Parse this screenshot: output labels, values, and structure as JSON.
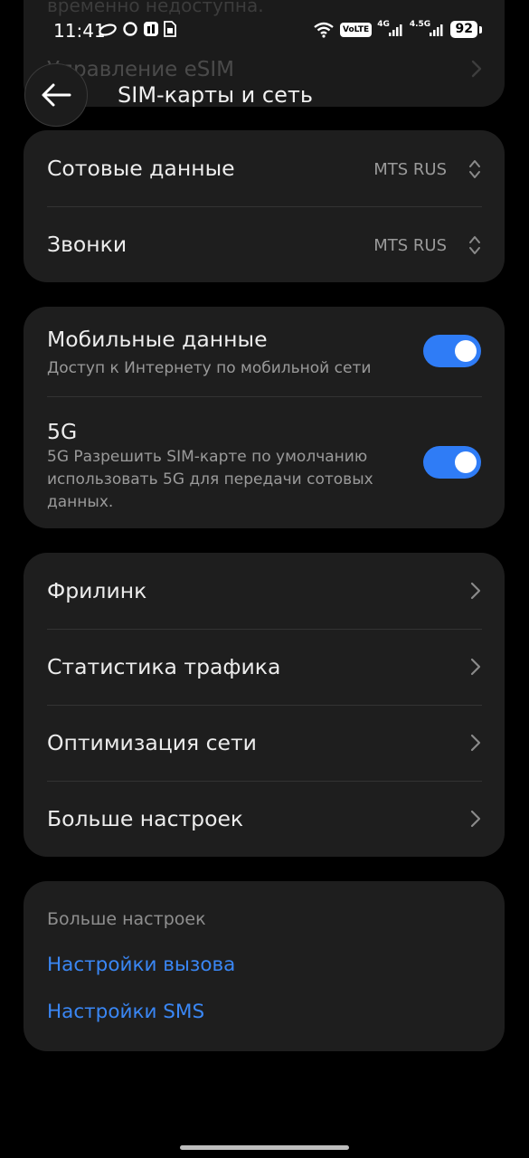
{
  "status_bar": {
    "time": "11:41",
    "volte": "VoLTE",
    "sim1_net": "4G",
    "sim2_net": "4.5G",
    "battery": "92",
    "icons_left": [
      "cloud-icon",
      "chat-icon",
      "notification-icon",
      "sim-icon"
    ],
    "icons_right": [
      "wifi-icon",
      "volte-icon",
      "signal-icon",
      "signal-icon",
      "battery-icon"
    ]
  },
  "background": {
    "partial_text": "временно недоступна.",
    "partial_item": "Управление eSIM"
  },
  "header": {
    "title": "SIM-карты и сеть",
    "back_icon": "arrow-left-icon"
  },
  "sim_card": {
    "rows": [
      {
        "label": "Сотовые данные",
        "value": "MTS RUS"
      },
      {
        "label": "Звонки",
        "value": "MTS RUS"
      }
    ]
  },
  "data_card": {
    "mobile_data": {
      "label": "Мобильные данные",
      "description": "Доступ к Интернету по мобильной сети",
      "enabled": true
    },
    "five_g": {
      "label": "5G",
      "description": "5G Разрешить SIM-карте по умолчанию использовать 5G для передачи сотовых данных.",
      "enabled": true
    }
  },
  "nav_card": {
    "items": [
      {
        "label": "Фрилинк"
      },
      {
        "label": "Статистика трафика"
      },
      {
        "label": "Оптимизация сети"
      },
      {
        "label": "Больше настроек"
      }
    ]
  },
  "more_card": {
    "caption": "Больше настроек",
    "links": [
      {
        "label": "Настройки вызова"
      },
      {
        "label": "Настройки SMS"
      }
    ]
  },
  "colors": {
    "accent": "#2f7cf6",
    "link": "#3a87f5",
    "card_bg": "#1e1e1e",
    "background": "#000000"
  }
}
